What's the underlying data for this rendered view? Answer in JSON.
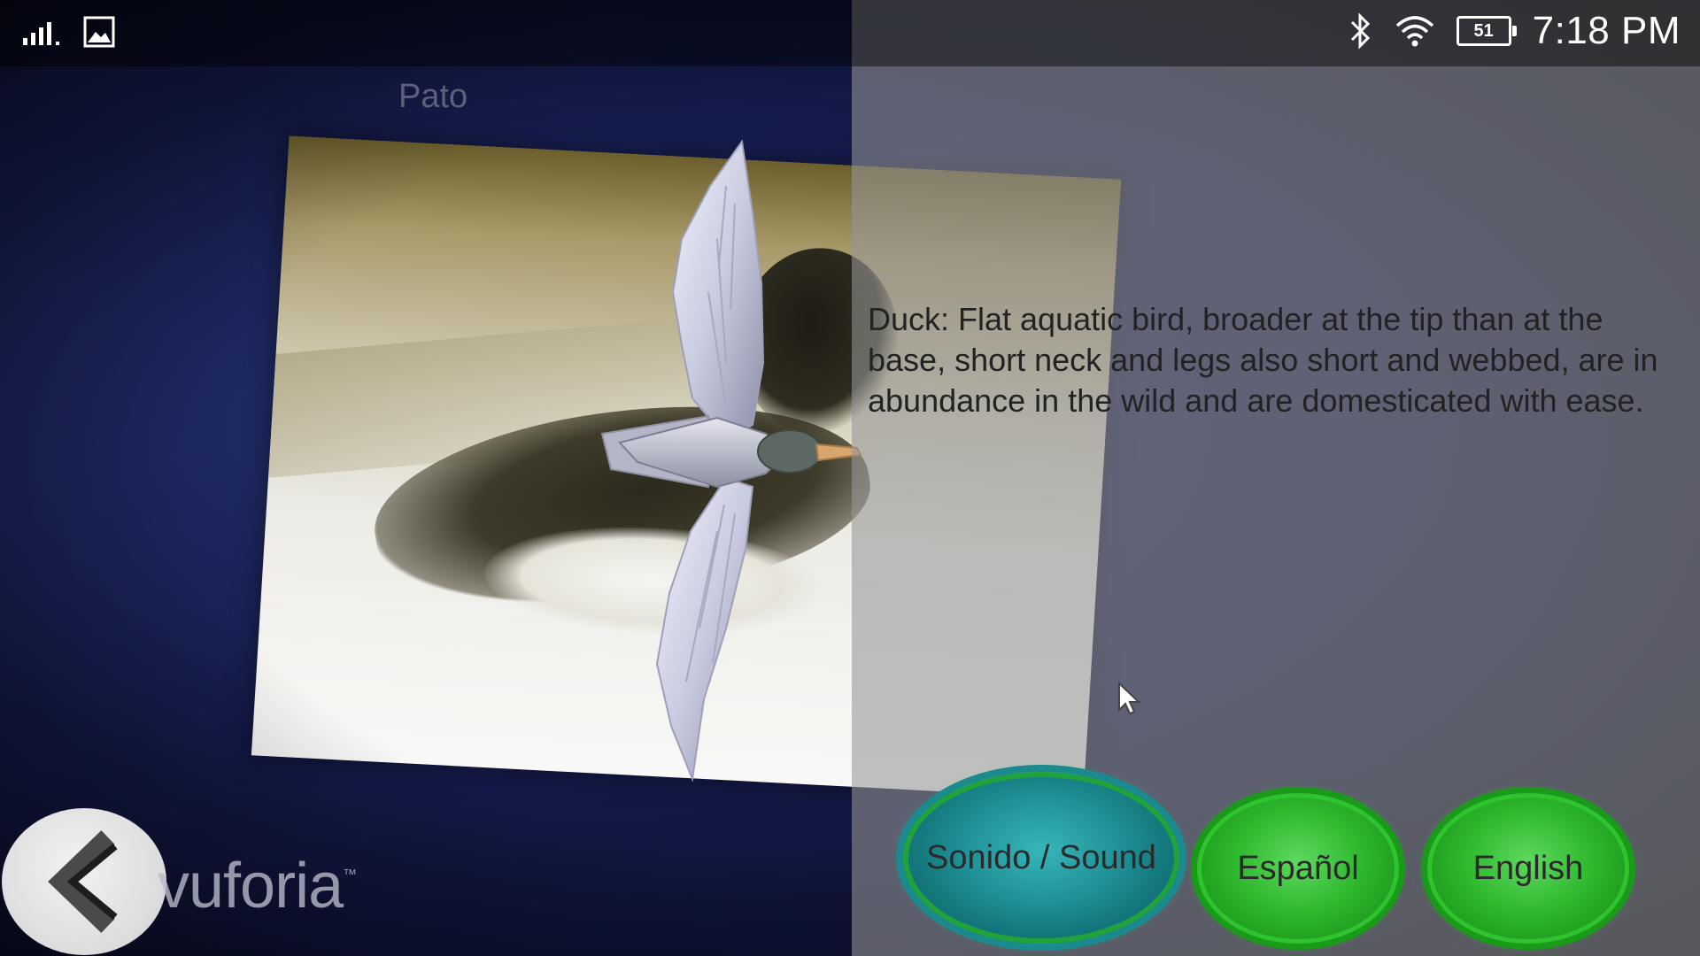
{
  "status_bar": {
    "time": "7:18 PM",
    "battery": "51",
    "icons": [
      "signal-icon",
      "image-notification-icon",
      "bluetooth-icon",
      "wifi-icon",
      "battery-icon"
    ]
  },
  "scene": {
    "title": "Pato",
    "description": "Duck: Flat aquatic bird, broader at the tip than at the base, short neck and legs also short and webbed, are in abundance in the wild and are domesticated with ease.",
    "watermark": "vuforia",
    "watermark_tm": "™"
  },
  "buttons": {
    "sound": "Sonido / Sound",
    "spanish": "Español",
    "english": "English"
  },
  "colors": {
    "sound_button": "#1d8e94",
    "language_button": "#2fba2f",
    "panel_overlay": "rgba(150,150,150,0.58)"
  }
}
